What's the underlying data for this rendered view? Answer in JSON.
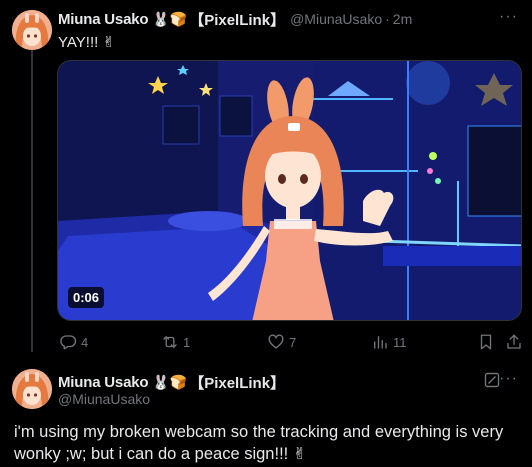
{
  "parent_tweet": {
    "author_name": "Miuna Usako",
    "author_emoji": "🐰🍞",
    "author_tag": "【PixelLink】",
    "handle": "@MiunaUsako",
    "separator": "·",
    "timestamp": "2m",
    "text": "YAY!!! ✌",
    "video_duration": "0:06",
    "replies": "4",
    "reposts": "1",
    "likes": "7",
    "views": "11"
  },
  "reply_tweet": {
    "author_name": "Miuna Usako",
    "author_emoji": "🐰🍞",
    "author_tag": "【PixelLink】",
    "handle": "@MiunaUsako",
    "text": "i'm using my broken webcam so the tracking and everything is very wonky ;w; but i can do a peace sign!!! ✌"
  },
  "more_label": "···",
  "colors": {
    "background": "#000000",
    "text": "#e7e9ea",
    "muted": "#71767b",
    "divider": "#2f3336"
  },
  "icons": [
    "reply-icon",
    "repost-icon",
    "like-icon",
    "views-icon",
    "bookmark-icon",
    "share-icon",
    "grok-icon",
    "more-icon"
  ]
}
